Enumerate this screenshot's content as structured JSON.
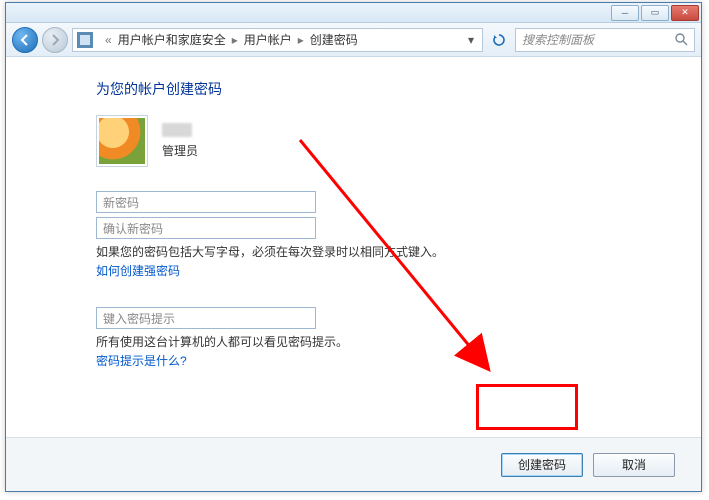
{
  "breadcrumb": {
    "seg1": "用户帐户和家庭安全",
    "seg2": "用户帐户",
    "seg3": "创建密码"
  },
  "search": {
    "placeholder": "搜索控制面板"
  },
  "page": {
    "title": "为您的帐户创建密码"
  },
  "account": {
    "role": "管理员"
  },
  "fields": {
    "new_password_placeholder": "新密码",
    "confirm_password_placeholder": "确认新密码",
    "hint_placeholder": "键入密码提示"
  },
  "helpers": {
    "caps_warning": "如果您的密码包括大写字母，必须在每次登录时以相同方式键入。",
    "strong_link": "如何创建强密码",
    "hint_warning": "所有使用这台计算机的人都可以看见密码提示。",
    "hint_link": "密码提示是什么?"
  },
  "buttons": {
    "create": "创建密码",
    "cancel": "取消"
  }
}
